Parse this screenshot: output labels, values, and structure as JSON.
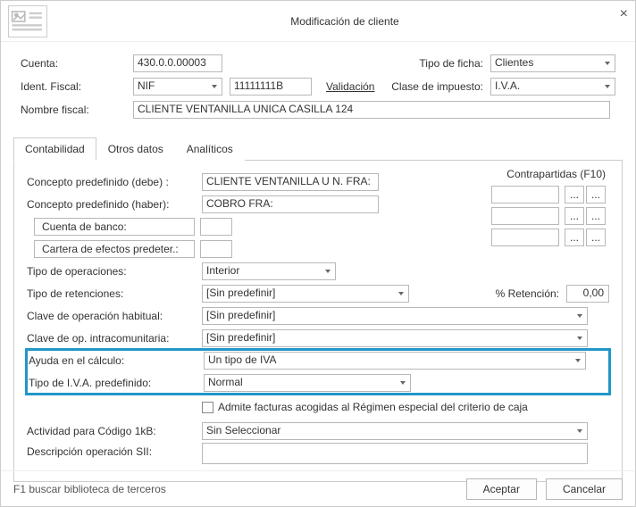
{
  "window": {
    "title": "Modificación de cliente",
    "close_icon": "×"
  },
  "top": {
    "cuenta_label": "Cuenta:",
    "cuenta_value": "430.0.0.00003",
    "tipo_ficha_label": "Tipo de ficha:",
    "tipo_ficha_value": "Clientes",
    "ident_fiscal_label": "Ident. Fiscal:",
    "ident_fiscal_type": "NIF",
    "ident_fiscal_value": "11111111B",
    "validacion_link": "Validación",
    "clase_impuesto_label": "Clase de impuesto:",
    "clase_impuesto_value": "I.V.A.",
    "nombre_fiscal_label": "Nombre fiscal:",
    "nombre_fiscal_value": "CLIENTE VENTANILLA UNICA CASILLA 124"
  },
  "tabs": {
    "contabilidad": "Contabilidad",
    "otros_datos": "Otros datos",
    "analiticos": "Analíticos"
  },
  "panel": {
    "concepto_debe_label": "Concepto predefinido (debe) :",
    "concepto_debe_value": "CLIENTE VENTANILLA U N. FRA:",
    "concepto_haber_label": "Concepto predefinido (haber):",
    "concepto_haber_value": "COBRO FRA:",
    "contrapartidas_label": "Contrapartidas (F10)",
    "cuenta_banco_btn": "Cuenta de banco:",
    "cuenta_banco_value": "",
    "cartera_btn": "Cartera de efectos predeter.:",
    "cartera_value": "",
    "tipo_op_label": "Tipo de operaciones:",
    "tipo_op_value": "Interior",
    "tipo_ret_label": "Tipo de retenciones:",
    "tipo_ret_value": "[Sin predefinir]",
    "pct_ret_label": "% Retención:",
    "pct_ret_value": "0,00",
    "clave_op_label": "Clave de operación habitual:",
    "clave_op_value": "[Sin predefinir]",
    "clave_intra_label": "Clave de op. intracomunitaria:",
    "clave_intra_value": "[Sin predefinir]",
    "ayuda_label": "Ayuda en el cálculo:",
    "ayuda_value": "Un tipo de IVA",
    "tipo_iva_label": "Tipo de I.V.A. predefinido:",
    "tipo_iva_value": "Normal",
    "admite_label": "Admite facturas acogidas al Régimen especial del criterio de caja",
    "actividad_label": "Actividad para Código 1kB:",
    "actividad_value": "Sin Seleccionar",
    "desc_sii_label": "Descripción operación SII:",
    "desc_sii_value": "",
    "ellipsis": "..."
  },
  "footer": {
    "help": "F1 buscar biblioteca de terceros",
    "aceptar": "Aceptar",
    "cancelar": "Cancelar"
  }
}
